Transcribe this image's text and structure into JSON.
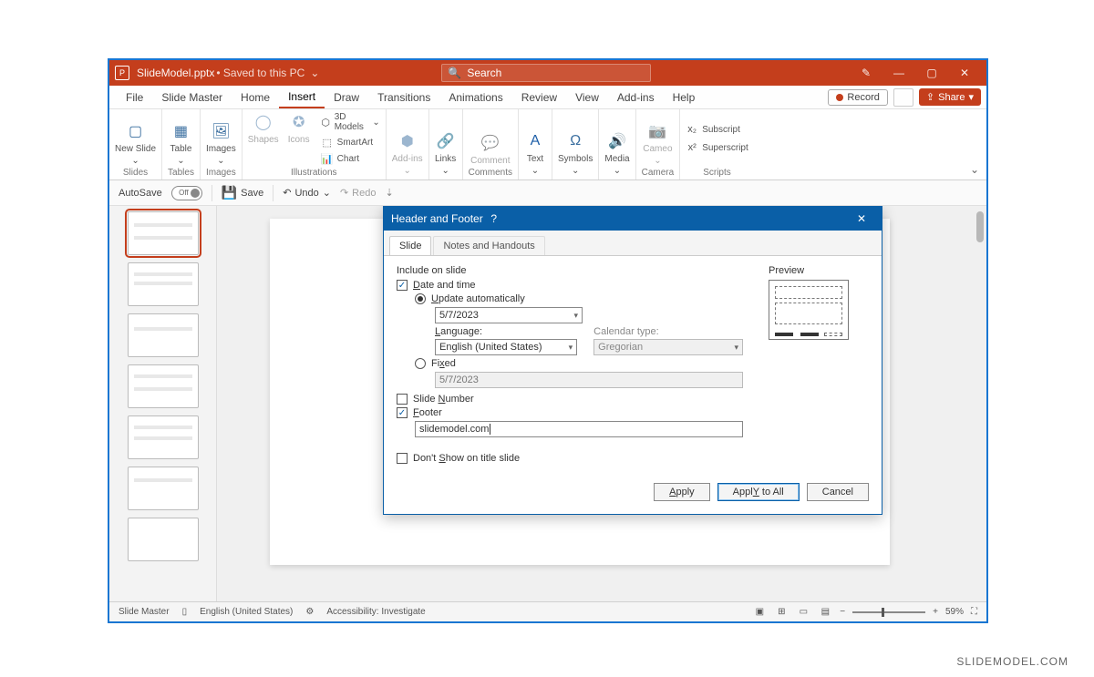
{
  "titlebar": {
    "docname": "SlideModel.pptx",
    "saved": " • Saved to this PC",
    "search_placeholder": "Search"
  },
  "menu": {
    "file": "File",
    "slidemaster": "Slide Master",
    "home": "Home",
    "insert": "Insert",
    "draw": "Draw",
    "transitions": "Transitions",
    "animations": "Animations",
    "review": "Review",
    "view": "View",
    "addins": "Add-ins",
    "help": "Help",
    "record": "Record",
    "share": "Share"
  },
  "ribbon": {
    "slides": {
      "lbl": "Slides",
      "new_slide": "New Slide"
    },
    "tables": {
      "lbl": "Tables",
      "table": "Table"
    },
    "images": {
      "lbl": "Images",
      "images": "Images"
    },
    "illustrations": {
      "lbl": "Illustrations",
      "shapes": "Shapes",
      "icons": "Icons",
      "models": "3D Models",
      "smartart": "SmartArt",
      "chart": "Chart"
    },
    "addins": {
      "lbl": " ",
      "addins": "Add-ins"
    },
    "links": {
      "lbl": " ",
      "links": "Links"
    },
    "comments": {
      "lbl": "Comments",
      "comment": "Comment"
    },
    "text": {
      "lbl": " ",
      "text": "Text"
    },
    "symbols": {
      "lbl": " ",
      "symbols": "Symbols"
    },
    "media": {
      "lbl": " ",
      "media": "Media"
    },
    "camera": {
      "lbl": "Camera",
      "cameo": "Cameo"
    },
    "scripts": {
      "lbl": "Scripts",
      "sub": "Subscript",
      "sup": "Superscript"
    }
  },
  "qat": {
    "autosave": "AutoSave",
    "off": "Off",
    "save": "Save",
    "undo": "Undo",
    "redo": "Redo"
  },
  "dialog": {
    "title": "Header and Footer",
    "tab_slide": "Slide",
    "tab_notes": "Notes and Handouts",
    "include": "Include on slide",
    "preview": "Preview",
    "datetime": "Date and time",
    "datetime_u": "D",
    "update": "Update automatically",
    "update_u": "U",
    "date_value": "5/7/2023",
    "language": "Language:",
    "language_u": "L",
    "language_value": "English (United States)",
    "caltype": "Calendar type:",
    "cal_value": "Gregorian",
    "fixed": "Fixed",
    "fixed_u": "x",
    "fixed_value": "5/7/2023",
    "slidenum": "Slide number",
    "slidenum_u": "N",
    "footer": "Footer",
    "footer_u": "F",
    "footer_value": "slidemodel.com",
    "dontshow": "Don't show on title slide",
    "dontshow_u": "S",
    "apply": "Apply",
    "apply_u": "A",
    "applyall": "Apply to All",
    "applyall_u": "Y",
    "cancel": "Cancel"
  },
  "status": {
    "mode": "Slide Master",
    "lang": "English (United States)",
    "acc": "Accessibility: Investigate",
    "zoom": "59%"
  },
  "slide": {
    "style": "style"
  },
  "watermark": "SLIDEMODEL.COM"
}
